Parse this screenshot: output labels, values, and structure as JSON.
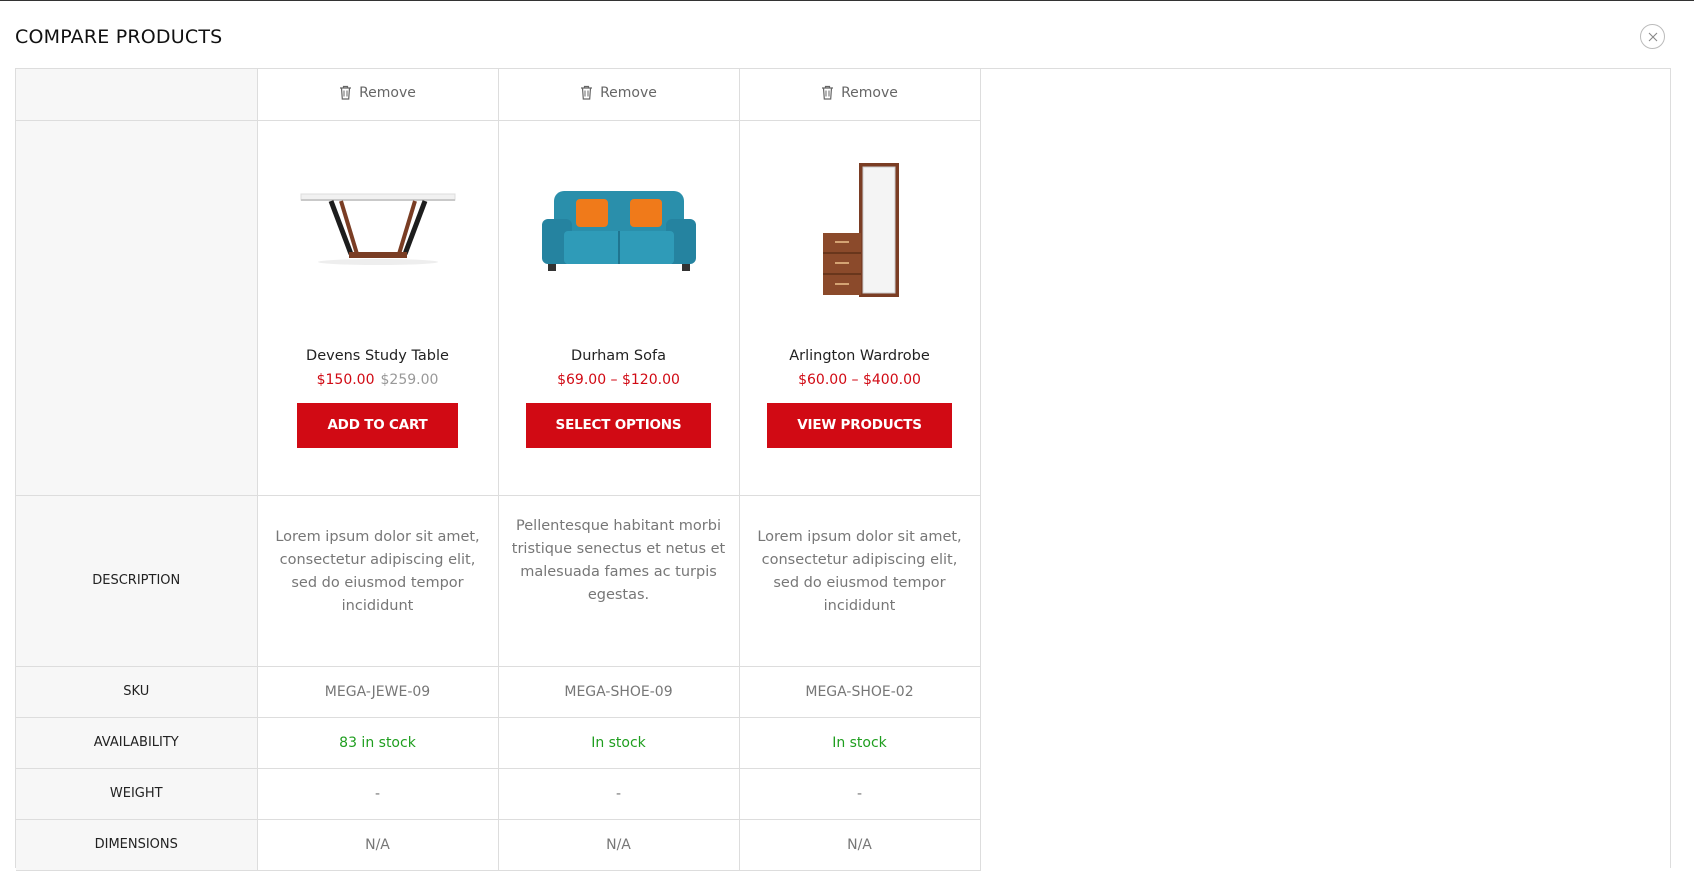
{
  "header": {
    "title": "COMPARE PRODUCTS"
  },
  "remove_label": "Remove",
  "products": [
    {
      "name": "Devens Study Table",
      "price": "$150.00",
      "old_price": "$259.00",
      "button": "ADD TO CART",
      "description": "Lorem ipsum dolor sit amet, consectetur adipiscing elit, sed do eiusmod tempor incididunt",
      "sku": "MEGA-JEWE-09",
      "availability": "83 in stock",
      "weight": "-",
      "dimensions": "N/A"
    },
    {
      "name": "Durham Sofa",
      "price": "$69.00 – $120.00",
      "old_price": "",
      "button": "SELECT OPTIONS",
      "description": "Pellentesque habitant morbi tristique senectus et netus et malesuada fames ac turpis egestas.",
      "sku": "MEGA-SHOE-09",
      "availability": "In stock",
      "weight": "-",
      "dimensions": "N/A"
    },
    {
      "name": "Arlington Wardrobe",
      "price": "$60.00 – $400.00",
      "old_price": "",
      "button": "VIEW PRODUCTS",
      "description": "Lorem ipsum dolor sit amet, consectetur adipiscing elit, sed do eiusmod tempor incididunt",
      "sku": "MEGA-SHOE-02",
      "availability": "In stock",
      "weight": "-",
      "dimensions": "N/A"
    }
  ],
  "labels": {
    "description": "DESCRIPTION",
    "sku": "SKU",
    "availability": "AVAILABILITY",
    "weight": "WEIGHT",
    "dimensions": "DIMENSIONS"
  },
  "colors": {
    "accent": "#d10a14",
    "stock": "#1f9e1f"
  }
}
